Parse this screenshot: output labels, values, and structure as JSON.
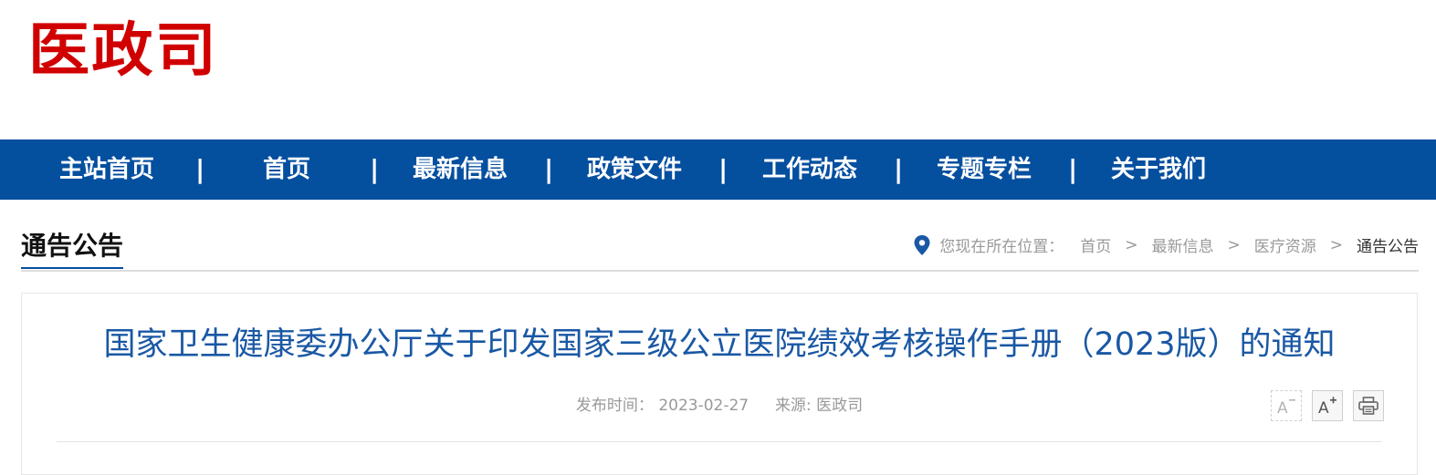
{
  "logo": {
    "text": "医政司"
  },
  "nav": {
    "items": [
      {
        "label": "主站首页"
      },
      {
        "label": "首页"
      },
      {
        "label": "最新信息"
      },
      {
        "label": "政策文件"
      },
      {
        "label": "工作动态"
      },
      {
        "label": "专题专栏"
      },
      {
        "label": "关于我们"
      }
    ],
    "separator": "|"
  },
  "section": {
    "title": "通告公告"
  },
  "breadcrumb": {
    "prefix": "您现在所在位置：",
    "items": [
      "首页",
      "最新信息",
      "医疗资源",
      "通告公告"
    ],
    "separator": ">"
  },
  "article": {
    "title": "国家卫生健康委办公厅关于印发国家三级公立医院绩效考核操作手册（2023版）的通知",
    "publish_label": "发布时间：",
    "publish_date": "2023-02-27",
    "source_label": "来源:",
    "source": "医政司"
  },
  "tools": {
    "decrease_font_icon": "font-decrease-icon",
    "increase_font_icon": "font-increase-icon",
    "print_icon": "print-icon"
  },
  "colors": {
    "brand_red": "#d10000",
    "nav_blue": "#054f9f",
    "title_blue": "#1a58a4"
  }
}
